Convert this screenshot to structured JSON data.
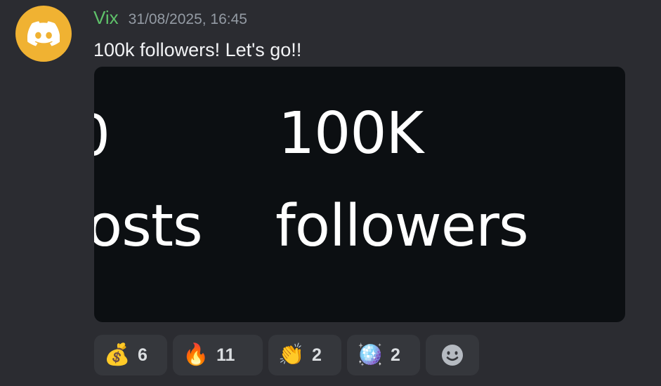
{
  "message": {
    "username": "Vix",
    "timestamp": "31/08/2025, 16:45",
    "text": "100k followers! Let's go!!",
    "avatar_icon": "discord-logo-icon",
    "avatar_color": "#f0b232",
    "username_color": "#5fc26a"
  },
  "image": {
    "partial_top": "0",
    "big_number": "100K",
    "partial_bottom": "osts",
    "followers_label": "followers"
  },
  "reactions": [
    {
      "emoji": "💰",
      "icon": "money-bag-icon",
      "count": "6"
    },
    {
      "emoji": "🔥",
      "icon": "fire-icon",
      "count": "11"
    },
    {
      "emoji": "👏",
      "icon": "clapping-hands-icon",
      "count": "2"
    },
    {
      "emoji": "🪩",
      "icon": "mirror-ball-icon",
      "count": "2"
    }
  ],
  "add_reaction": {
    "icon": "add-reaction-smiley-icon"
  }
}
